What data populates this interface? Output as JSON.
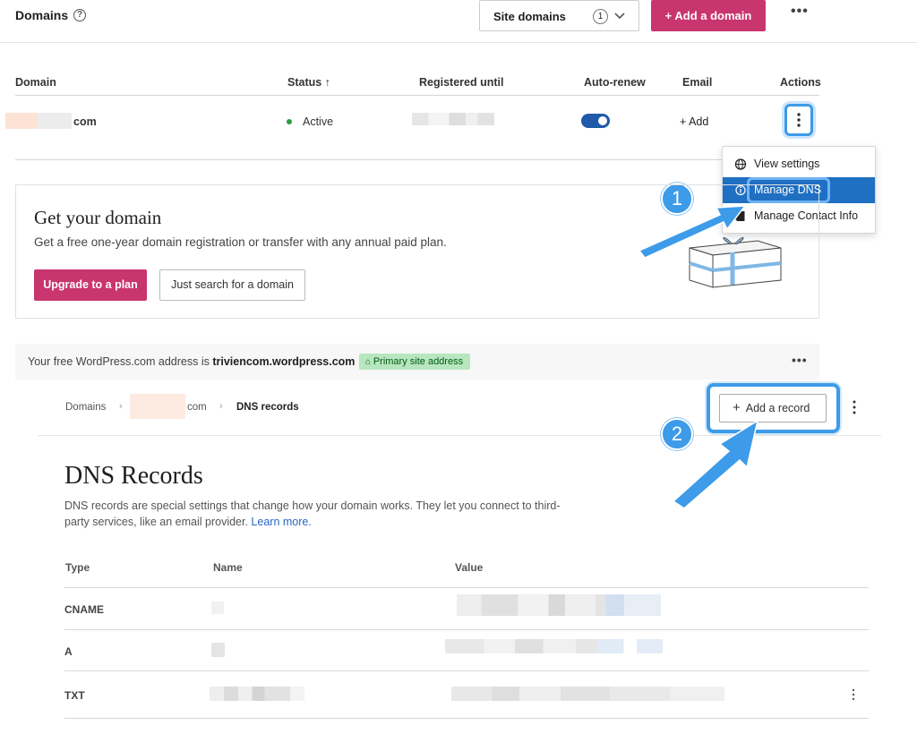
{
  "header": {
    "title": "Domains",
    "help_icon": "?",
    "site_select_label": "Site domains",
    "site_select_count": "1",
    "add_domain_label": "+ Add a domain",
    "more_icon": "•••"
  },
  "domains_table": {
    "columns": [
      "Domain",
      "Status ↑",
      "Registered until",
      "Auto-renew",
      "Email",
      "Actions"
    ],
    "rows": [
      {
        "domain_suffix": "com",
        "status": "Active",
        "auto_renew": true,
        "email": "+ Add"
      }
    ]
  },
  "actions_menu": {
    "items": [
      {
        "label": "View settings",
        "icon": "globe-icon",
        "glyph": "🌐"
      },
      {
        "label": "Manage DNS",
        "icon": "info-icon",
        "glyph": "ⓘ"
      },
      {
        "label": "Manage Contact Info",
        "icon": "contact-card-icon",
        "glyph": "▪"
      }
    ]
  },
  "callouts": {
    "step1": "1",
    "step2": "2"
  },
  "promo": {
    "title": "Get your domain",
    "text": "Get a free one-year domain registration or transfer with any annual paid plan.",
    "upgrade_label": "Upgrade to a plan",
    "search_label": "Just search for a domain"
  },
  "free_address": {
    "prefix": "Your free WordPress.com address is ",
    "address": "triviencom.wordpress.com",
    "badge": "Primary site address",
    "more_icon": "•••"
  },
  "breadcrumb": {
    "root": "Domains",
    "domain_suffix": "com",
    "current": "DNS records"
  },
  "add_record_label": "Add a record",
  "dns": {
    "title": "DNS Records",
    "description": "DNS records are special settings that change how your domain works. They let you connect to third-party services, like an email provider. ",
    "learn_more": "Learn more.",
    "columns": [
      "Type",
      "Name",
      "Value"
    ],
    "rows": [
      {
        "type": "CNAME"
      },
      {
        "type": "A"
      },
      {
        "type": "TXT"
      }
    ]
  },
  "colors": {
    "brand_pink": "#c9356e",
    "accent_blue": "#1f6fc2",
    "callout_blue": "#3d9be9",
    "success_green": "#2a9c3f"
  }
}
